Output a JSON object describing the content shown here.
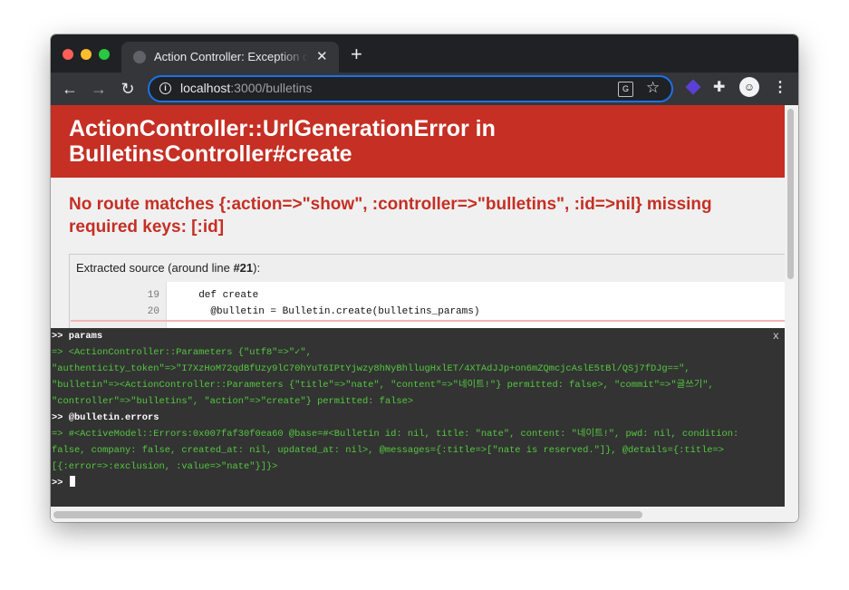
{
  "browser": {
    "tab": {
      "title": "Action Controller: Exception caught",
      "close": "✕"
    },
    "new_tab": "+",
    "nav": {
      "back": "←",
      "forward": "→",
      "reload": "↻"
    },
    "url": {
      "host": "localhost",
      "path": ":3000/bulletins"
    },
    "icons": {
      "info": "i",
      "translate": "G",
      "star": "☆",
      "puzzle": "✚",
      "avatar": "☺",
      "menu": "⋮"
    }
  },
  "error": {
    "title": "ActionController::UrlGenerationError in BulletinsController#create",
    "message": "No route matches {:action=>\"show\", :controller=>\"bulletins\", :id=>nil} missing required keys: [:id]",
    "source": {
      "caption_prefix": "Extracted source (around line ",
      "line": "#21",
      "caption_suffix": "):",
      "lines": [
        {
          "num": "19",
          "code": "  def create"
        },
        {
          "num": "20",
          "code": "    @bulletin = Bulletin.create(bulletins_params)"
        }
      ]
    }
  },
  "console": {
    "close": "x",
    "lines": [
      ">> params",
      "=> <ActionController::Parameters {\"utf8\"=>\"✓\",",
      "\"authenticity_token\"=>\"I7XzHoM72qdBfUzy9lC70hYuT6IPtYjwzy8hNyBhllugHxlET/4XTAdJJp+on6mZQmcjcAslE5tBl/QSj7fDJg==\",",
      "\"bulletin\"=><ActionController::Parameters {\"title\"=>\"nate\", \"content\"=>\"네이트!\"} permitted: false>, \"commit\"=>\"글쓰기\",",
      "\"controller\"=>\"bulletins\", \"action\"=>\"create\"} permitted: false>",
      ">> @bulletin.errors",
      "=> #<ActiveModel::Errors:0x007faf30f0ea60 @base=#<Bulletin id: nil, title: \"nate\", content: \"네이트!\", pwd: nil, condition:",
      "false, company: false, created_at: nil, updated_at: nil>, @messages={:title=>[\"nate is reserved.\"]}, @details={:title=>",
      "[{:error=>:exclusion, :value=>\"nate\"}]}>",
      ">> "
    ]
  },
  "colors": {
    "accent": "#1a73e8",
    "error_red": "#c52f24",
    "console_green": "#54c840"
  }
}
